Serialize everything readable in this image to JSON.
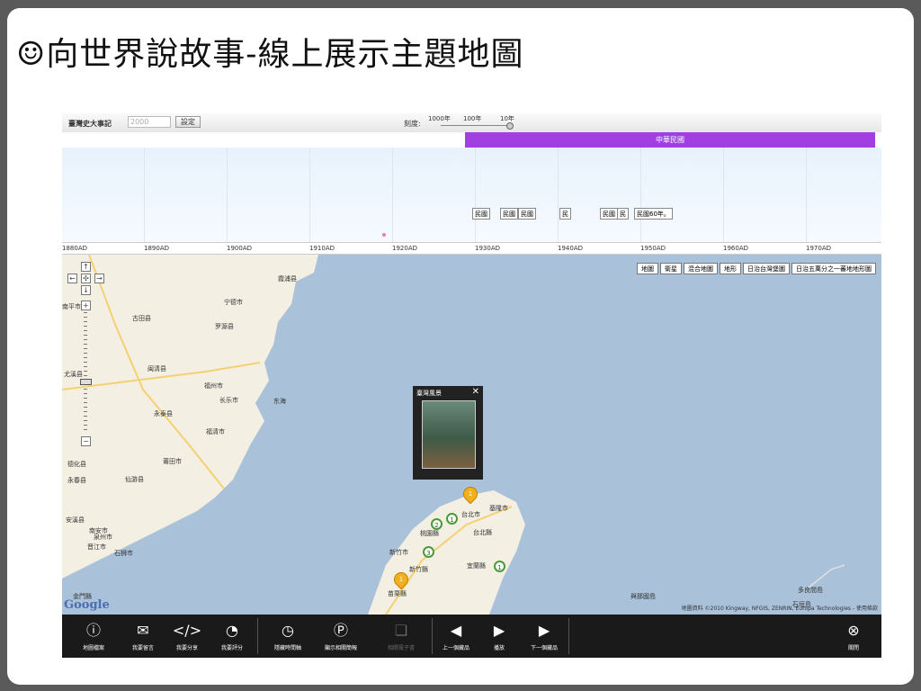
{
  "slide": {
    "title": "☺向世界說故事-線上展示主題地圖"
  },
  "topbar": {
    "app_title": "臺灣史大事記",
    "year_input_value": "2000",
    "set_button": "設定",
    "scale_label": "刻度:",
    "scale_options": [
      "1000年",
      "100年",
      "10年"
    ]
  },
  "era": {
    "label": "中華民國",
    "color": "#a040e0"
  },
  "timeline": {
    "axis_labels": [
      "1880AD",
      "1890AD",
      "1900AD",
      "1910AD",
      "1920AD",
      "1930AD",
      "1940AD",
      "1950AD",
      "1960AD",
      "1970AD"
    ],
    "events": [
      "民國",
      "民國",
      "民國",
      "民",
      "民國",
      "民",
      "民國60年。"
    ]
  },
  "map": {
    "layer_buttons": [
      "地圖",
      "衛星",
      "混合地圖",
      "地形",
      "日治台灣堡圖",
      "日治五萬分之一蕃地地形圖"
    ],
    "places": [
      "霞浦县",
      "宁德市",
      "古田县",
      "罗源县",
      "闽清县",
      "永泰县",
      "福州市",
      "长乐市",
      "东海",
      "福清市",
      "莆田市",
      "仙游县",
      "泉州市",
      "晋江市",
      "石狮市",
      "安溪县",
      "南安市",
      "南平市",
      "尤溪县",
      "德化县",
      "永春县",
      "基隆市",
      "台北市",
      "台北縣",
      "桃園縣",
      "新竹市",
      "新竹縣",
      "宜蘭縣",
      "苗栗縣",
      "金門縣",
      "與那國島",
      "多良間島",
      "石垣島"
    ],
    "popup_title": "臺灣風景",
    "popup_close": "✕",
    "marker_numbers": [
      "1",
      "1",
      "2",
      "1",
      "3",
      "1"
    ],
    "google_logo": "Google",
    "copyright": "地圖資料 ©2010 Kingway, NFGIS, ZENRIN, Europa Technologies - 使用條款"
  },
  "toolbar": {
    "tools": [
      {
        "icon": "ⓘ",
        "label": "地圖檔案"
      },
      {
        "icon": "✉",
        "label": "我要留言"
      },
      {
        "icon": "</>",
        "label": "我要分享"
      },
      {
        "icon": "◔",
        "label": "我要評分"
      },
      {
        "icon": "◷",
        "label": "隱藏時間軸"
      },
      {
        "icon": "Ⓟ",
        "label": "顯示相關簡報"
      },
      {
        "icon": "❏",
        "label": "相關電子書"
      },
      {
        "icon": "◀",
        "label": "上一個藏品"
      },
      {
        "icon": "▶",
        "label": "播放"
      },
      {
        "icon": "▶",
        "label": "下一個藏品"
      },
      {
        "icon": "⊗",
        "label": "關閉"
      }
    ]
  }
}
